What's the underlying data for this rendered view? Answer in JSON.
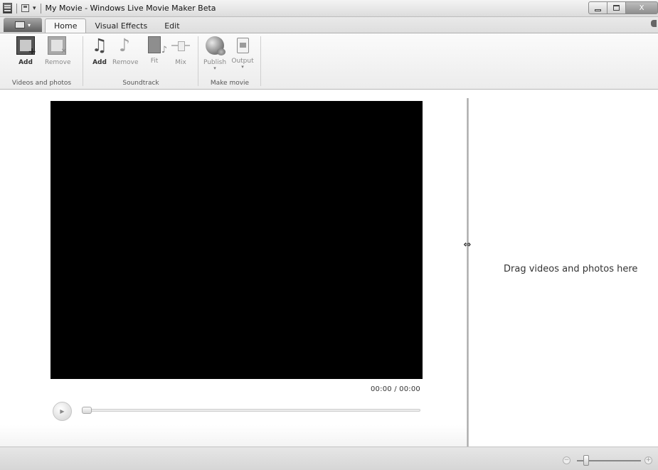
{
  "window": {
    "title": "My Movie - Windows Live Movie Maker Beta",
    "controls": {
      "minimize": "minimize",
      "maximize": "maximize",
      "close": "X"
    }
  },
  "ribbon_tabs": [
    {
      "label": "Home",
      "active": true
    },
    {
      "label": "Visual Effects",
      "active": false
    },
    {
      "label": "Edit",
      "active": false
    }
  ],
  "ribbon_groups": {
    "videos_and_photos": {
      "label": "Videos and photos",
      "buttons": [
        {
          "label": "Add",
          "icon": "add-video-icon",
          "enabled": true
        },
        {
          "label": "Remove",
          "icon": "remove-video-icon",
          "enabled": false
        }
      ]
    },
    "soundtrack": {
      "label": "Soundtrack",
      "buttons": [
        {
          "label": "Add",
          "icon": "add-music-icon",
          "enabled": true
        },
        {
          "label": "Remove",
          "icon": "remove-music-icon",
          "enabled": false
        },
        {
          "label": "Fit",
          "icon": "fit-music-icon",
          "enabled": false
        },
        {
          "label": "Mix",
          "icon": "mix-slider-icon",
          "enabled": false
        }
      ]
    },
    "make_movie": {
      "label": "Make movie",
      "buttons": [
        {
          "label": "Publish",
          "icon": "globe-icon",
          "enabled": false
        },
        {
          "label": "Output",
          "icon": "output-document-icon",
          "enabled": false
        }
      ]
    }
  },
  "player": {
    "time_readout": "00:00 / 00:00",
    "play_glyph": "▶",
    "seek_progress": 0
  },
  "storyboard": {
    "hint": "Drag videos and photos here"
  },
  "statusbar": {
    "zoom_out_glyph": "−",
    "zoom_in_glyph": "+",
    "zoom_level": 0.1
  },
  "colors": {
    "preview_background": "#000000",
    "ribbon_background": "#f4f4f4"
  }
}
